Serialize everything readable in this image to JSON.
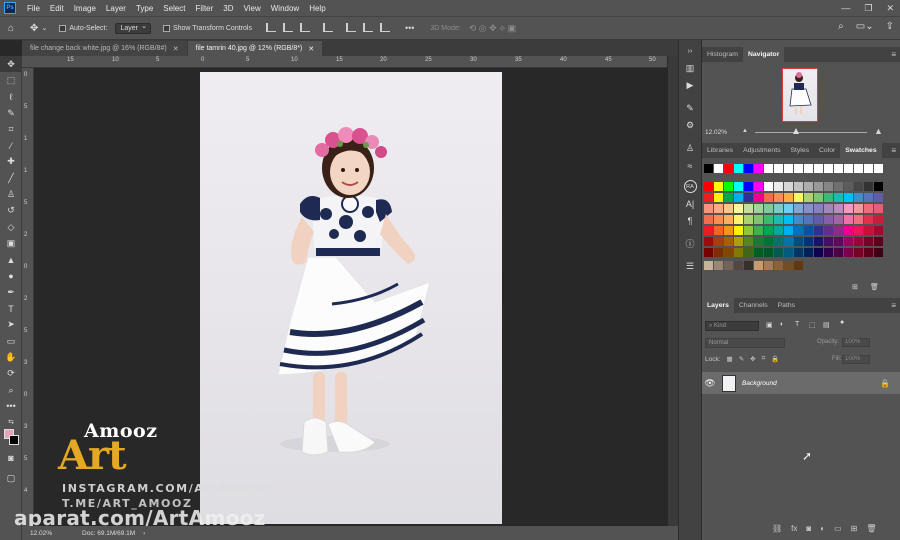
{
  "menu": {
    "app_icon": "Ps",
    "items": [
      "File",
      "Edit",
      "Image",
      "Layer",
      "Type",
      "Select",
      "Filter",
      "3D",
      "View",
      "Window",
      "Help"
    ]
  },
  "options_bar": {
    "auto_select_label": "Auto-Select:",
    "auto_select_value": "Layer",
    "show_transform_label": "Show Transform Controls",
    "three_d_mode_label": "3D Mode:"
  },
  "tabs": [
    {
      "label": "file change back white.jpg @ 16% (RGB/8#)",
      "active": false
    },
    {
      "label": "file tamrin 40.jpg @ 12% (RGB/8*)",
      "active": true
    }
  ],
  "ruler_top_labels": [
    "15",
    "10",
    "5",
    "0",
    "5",
    "10",
    "15",
    "20",
    "25",
    "30",
    "35",
    "40",
    "45",
    "50"
  ],
  "ruler_left_labels": [
    "0",
    "5",
    "1",
    "1",
    "5",
    "2",
    "0",
    "2",
    "5",
    "3",
    "0",
    "3",
    "5",
    "4"
  ],
  "status_bar": {
    "zoom": "12.02%",
    "doc": "Doc: 69.1M/69.1M"
  },
  "watermark": {
    "amooz": "Amooz",
    "art": "Art",
    "instagram": "INSTAGRAM.COM/ArtAmooz",
    "telegram": "T.ME/ART_AMOOZ",
    "aparat": "aparat.com/ArtAmooz"
  },
  "panels": {
    "top_tabs": [
      "Histogram",
      "Navigator"
    ],
    "navigator_zoom": "12.02%",
    "middle_tabs": [
      "Libraries",
      "Adjustments",
      "Styles",
      "Color",
      "Swatches"
    ],
    "layers_tabs": [
      "Layers",
      "Channels",
      "Paths"
    ],
    "kind_placeholder": "Kind",
    "blend_mode": "Normal",
    "opacity_label": "Opacity:",
    "opacity_value": "100%",
    "lock_label": "Lock:",
    "fill_label": "Fill:",
    "fill_value": "100%",
    "layer_name": "Background"
  },
  "swatch_colors": [
    [
      "#000000",
      "#ffffff",
      "#ff0000",
      "#00ffff",
      "#0000ff",
      "#ff00ff",
      "#ffffff",
      "#ffffff",
      "#ffffff",
      "#ffffff",
      "#ffffff",
      "#ffffff",
      "#ffffff",
      "#ffffff",
      "#ffffff",
      "#ffffff",
      "#ffffff",
      "#ffffff"
    ],
    [
      "#ff0000",
      "#ffff00",
      "#00ff00",
      "#00ffff",
      "#0000ff",
      "#ff00ff",
      "#ffffff",
      "#ebebeb",
      "#d6d6d6",
      "#c2c2c2",
      "#adadad",
      "#999999",
      "#858585",
      "#707070",
      "#5c5c5c",
      "#474747",
      "#333333",
      "#000000"
    ],
    [
      "#ee1d24",
      "#fff100",
      "#00a650",
      "#00aeef",
      "#2f3192",
      "#ed008c",
      "#f26c4f",
      "#f68e55",
      "#fbad4a",
      "#fff467",
      "#acd372",
      "#7dc473",
      "#3cb878",
      "#1bbbb4",
      "#00bff3",
      "#438ccb",
      "#5574b9",
      "#605ca8"
    ],
    [
      "#f69679",
      "#f9ad81",
      "#fdc68a",
      "#fff79a",
      "#c4df9b",
      "#a3d39c",
      "#82ca9c",
      "#7accc8",
      "#6dcff6",
      "#7da7d8",
      "#8393ca",
      "#8781bd",
      "#a186be",
      "#bd8cbf",
      "#f49ac1",
      "#f5989d",
      "#f26b7a",
      "#e85d75"
    ],
    [
      "#f26c4f",
      "#f68e55",
      "#fbaf5c",
      "#fff467",
      "#acd372",
      "#7cc576",
      "#3bb878",
      "#1abbb4",
      "#00bff3",
      "#438ccb",
      "#5674b9",
      "#605ca8",
      "#855fa8",
      "#a763a8",
      "#f06ea9",
      "#f26d7d",
      "#e0324b",
      "#c81e3c"
    ],
    [
      "#ed1c24",
      "#f26522",
      "#f7941d",
      "#fff200",
      "#8dc63f",
      "#39b54a",
      "#00a651",
      "#00a99d",
      "#00aeef",
      "#0072bc",
      "#0054a6",
      "#2e3192",
      "#662d91",
      "#92278f",
      "#ec008c",
      "#ed145b",
      "#c4113a",
      "#9e0b2f"
    ],
    [
      "#9e0b0f",
      "#a0410d",
      "#a36209",
      "#aba000",
      "#598527",
      "#1a7b30",
      "#007236",
      "#00746b",
      "#0076a3",
      "#004b80",
      "#003471",
      "#1b1464",
      "#440e62",
      "#630460",
      "#9e005d",
      "#9e0039",
      "#7a0027",
      "#5a001d"
    ],
    [
      "#790000",
      "#7b2e00",
      "#7d4900",
      "#827b00",
      "#406618",
      "#005e20",
      "#005826",
      "#005952",
      "#005b7f",
      "#003663",
      "#002157",
      "#0d004c",
      "#32004b",
      "#4b0049",
      "#7b0046",
      "#7a0026",
      "#5e001a",
      "#3e0012"
    ],
    [
      "#c7b299",
      "#998675",
      "#736357",
      "#534741",
      "#37302d",
      "#c69c6d",
      "#a67c52",
      "#8c6239",
      "#754c24",
      "#603913",
      "",
      "",
      "",
      "",
      "",
      "",
      "",
      ""
    ]
  ]
}
